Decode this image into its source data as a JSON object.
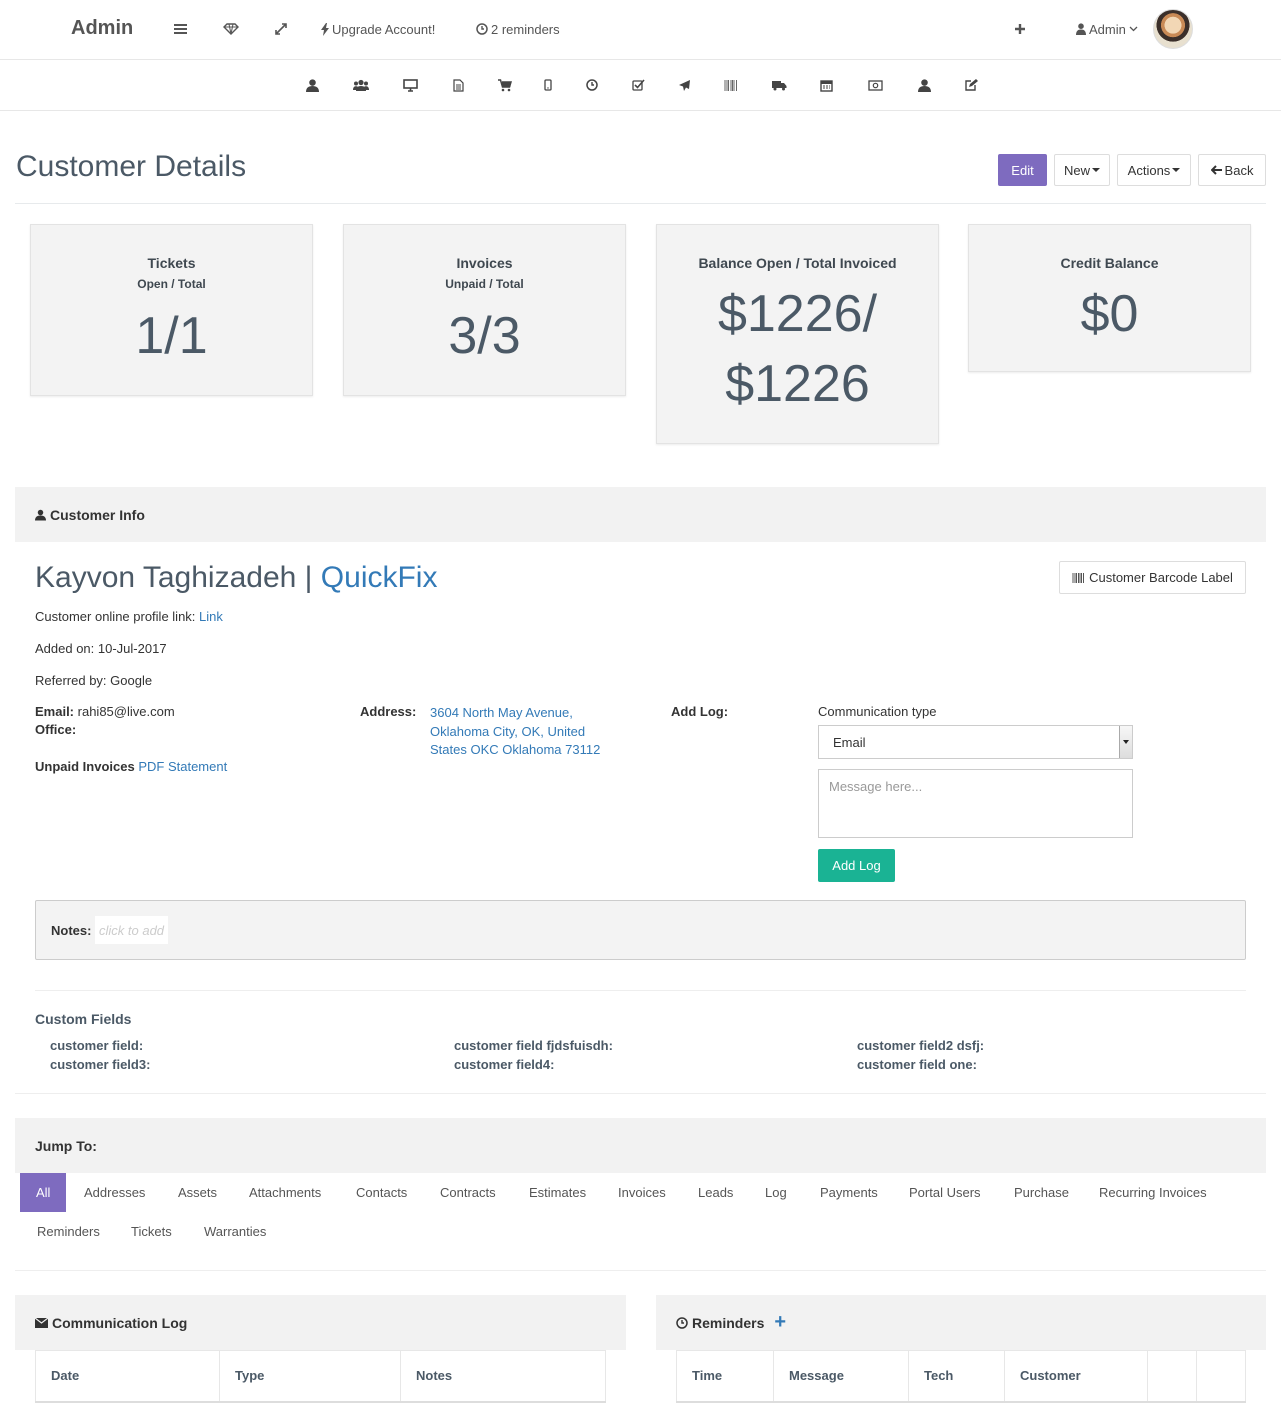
{
  "topbar": {
    "brand": "Admin",
    "upgrade": "Upgrade Account!",
    "reminders": "2 reminders",
    "user": "Admin"
  },
  "nav_icons": [
    "user-icon",
    "users-icon",
    "desktop-icon",
    "file-icon",
    "cart-icon",
    "mobile-icon",
    "clock-icon",
    "check-icon",
    "plane-icon",
    "barcode-icon",
    "truck-icon",
    "calendar-icon",
    "money-icon",
    "user-alt-icon",
    "edit-icon"
  ],
  "header": {
    "title": "Customer Details",
    "edit": "Edit",
    "new": "New",
    "actions": "Actions",
    "back": "Back"
  },
  "stats": [
    {
      "title": "Tickets",
      "sub": "Open / Total",
      "value": "1/1"
    },
    {
      "title": "Invoices",
      "sub": "Unpaid / Total",
      "value": "3/3"
    },
    {
      "title": "Balance Open / Total Invoiced",
      "value_line1": "$1226/",
      "value_line2": "$1226"
    },
    {
      "title": "Credit Balance",
      "value": "$0"
    }
  ],
  "customer_info": {
    "heading": "Customer Info",
    "name": "Kayvon Taghizadeh",
    "separator": " | ",
    "company": "QuickFix",
    "barcode_btn": "Customer Barcode Label",
    "profile_label": "Customer online profile link:",
    "profile_link": "Link",
    "added_on": "Added on: 10-Jul-2017",
    "referred_by": "Referred by: Google",
    "email_label": "Email:",
    "email": "rahi85@live.com",
    "office_label": "Office:",
    "unpaid_label": "Unpaid Invoices",
    "pdf_statement": "PDF Statement",
    "address_label": "Address:",
    "address_line1": "3604 North May Avenue,",
    "address_line2": "Oklahoma City, OK, United",
    "address_line3": "States OKC Oklahoma 73112",
    "add_log_label": "Add Log:",
    "comm_type_label": "Communication type",
    "comm_type_value": "Email",
    "message_placeholder": "Message here...",
    "add_log_btn": "Add Log",
    "notes_label": "Notes:",
    "notes_placeholder": "click to add"
  },
  "custom_fields": {
    "title": "Custom Fields",
    "fields": [
      "customer field:",
      "customer field3:",
      "customer field fjdsfuisdh:",
      "customer field4:",
      "customer field2 dsfj:",
      "customer field one:"
    ]
  },
  "jump_to": {
    "heading": "Jump To:",
    "tabs": [
      "All",
      "Addresses",
      "Assets",
      "Attachments",
      "Contacts",
      "Contracts",
      "Estimates",
      "Invoices",
      "Leads",
      "Log",
      "Payments",
      "Portal Users",
      "Purchase",
      "Recurring Invoices",
      "Reminders",
      "Tickets",
      "Warranties"
    ],
    "active": "All"
  },
  "comm_log": {
    "heading": "Communication Log",
    "columns": [
      "Date",
      "Type",
      "Notes"
    ]
  },
  "reminders": {
    "heading": "Reminders",
    "columns": [
      "Time",
      "Message",
      "Tech",
      "Customer",
      "",
      ""
    ]
  }
}
